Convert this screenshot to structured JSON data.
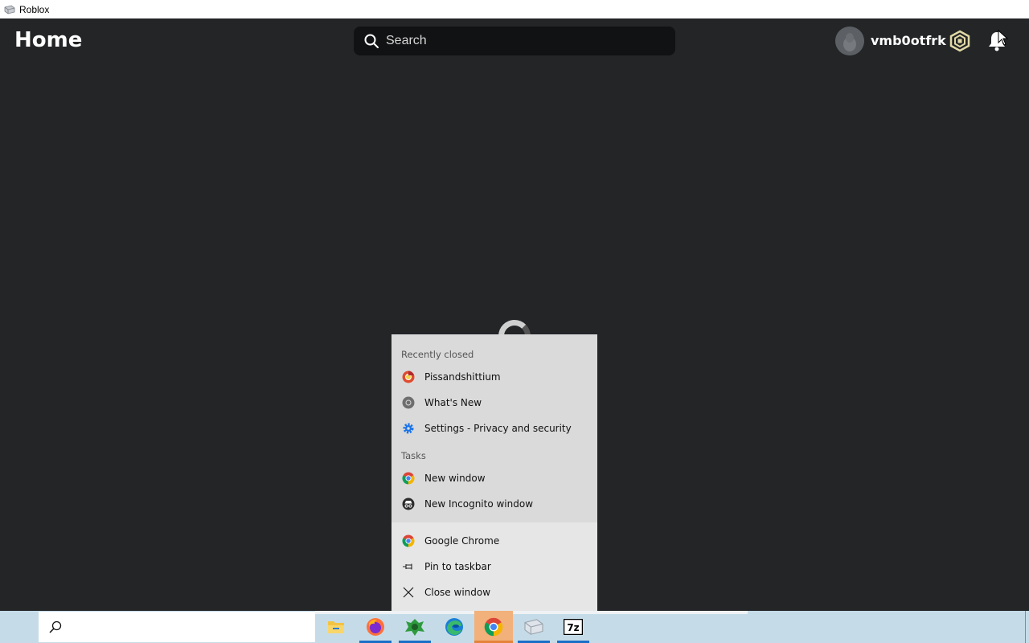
{
  "window": {
    "title": "Roblox"
  },
  "header": {
    "page_title": "Home",
    "search_placeholder": "Search",
    "username": "vmb0otfrk"
  },
  "jumplist": {
    "recent_header": "Recently closed",
    "recent_items": [
      {
        "label": "Pissandshittium",
        "icon": "chromium-favicon"
      },
      {
        "label": "What's New",
        "icon": "chrome-grey-icon"
      },
      {
        "label": "Settings - Privacy and security",
        "icon": "settings-gear-icon"
      }
    ],
    "tasks_header": "Tasks",
    "task_items": [
      {
        "label": "New window",
        "icon": "chrome-icon"
      },
      {
        "label": "New Incognito window",
        "icon": "incognito-icon"
      }
    ],
    "app_items": [
      {
        "label": "Google Chrome",
        "icon": "chrome-icon"
      },
      {
        "label": "Pin to taskbar",
        "icon": "pin-icon"
      },
      {
        "label": "Close window",
        "icon": "close-icon"
      }
    ]
  },
  "taskbar": {
    "apps": [
      "File Explorer",
      "Firefox",
      "Green app",
      "Microsoft Edge",
      "Google Chrome",
      "Roblox",
      "7-Zip"
    ],
    "sevenzip_label": "7z"
  },
  "colors": {
    "background": "#232527",
    "search_bg": "#111214",
    "jumplist_bg": "#dadada",
    "taskbar_bg": "#c5dce8",
    "active_app": "#f2b07a"
  }
}
